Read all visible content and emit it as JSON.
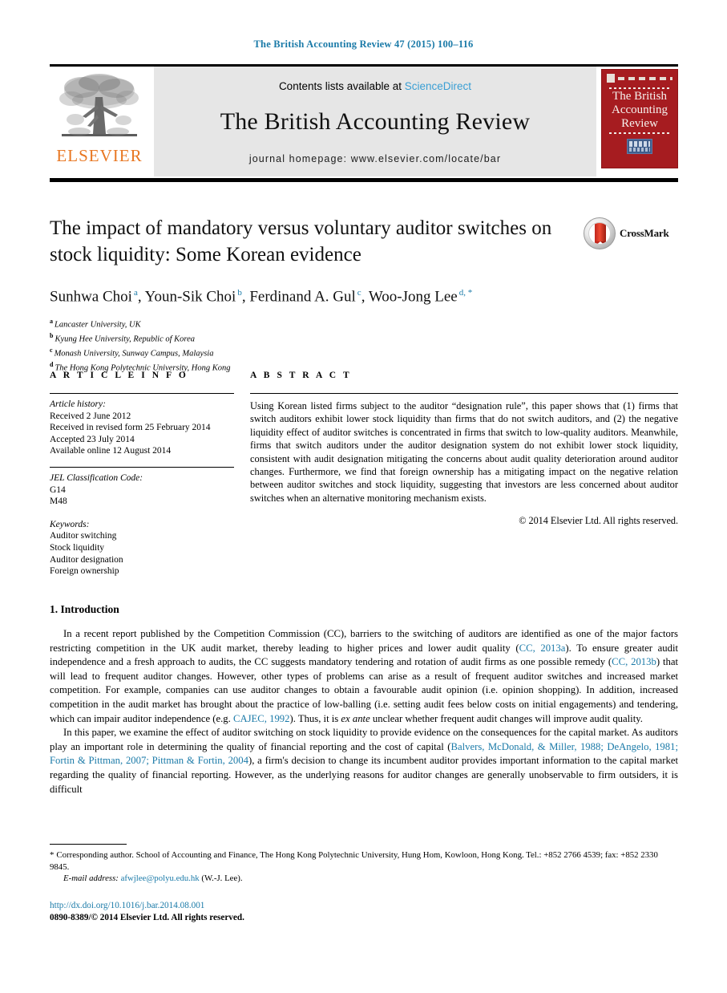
{
  "running_head": "The British Accounting Review 47 (2015) 100–116",
  "masthead": {
    "publisher_name": "ELSEVIER",
    "contents_prefix": "Contents lists available at ",
    "contents_link": "ScienceDirect",
    "journal_title": "The British Accounting Review",
    "homepage": "journal homepage: www.elsevier.com/locate/bar",
    "cover": {
      "line1": "The British",
      "line2": "Accounting",
      "line3": "Review",
      "society_badge": "BAFA"
    }
  },
  "article": {
    "title": "The impact of mandatory versus voluntary auditor switches on stock liquidity: Some Korean evidence",
    "crossmark_label": "CrossMark",
    "authors": [
      {
        "name": "Sunhwa Choi",
        "marks": "a"
      },
      {
        "name": "Youn-Sik Choi",
        "marks": "b"
      },
      {
        "name": "Ferdinand A. Gul",
        "marks": "c"
      },
      {
        "name": "Woo-Jong Lee",
        "marks": "d, *"
      }
    ],
    "affiliations": [
      {
        "mark": "a",
        "text": "Lancaster University, UK"
      },
      {
        "mark": "b",
        "text": "Kyung Hee University, Republic of Korea"
      },
      {
        "mark": "c",
        "text": "Monash University, Sunway Campus, Malaysia"
      },
      {
        "mark": "d",
        "text": "The Hong Kong Polytechnic University, Hong Kong"
      }
    ]
  },
  "article_info": {
    "heading": "A R T I C L E    I N F O",
    "history_label": "Article history:",
    "history": [
      "Received 2 June 2012",
      "Received in revised form 25 February 2014",
      "Accepted 23 July 2014",
      "Available online 12 August 2014"
    ],
    "jel_label": "JEL Classification Code:",
    "jel_codes": [
      "G14",
      "M48"
    ],
    "keywords_label": "Keywords:",
    "keywords": [
      "Auditor switching",
      "Stock liquidity",
      "Auditor designation",
      "Foreign ownership"
    ]
  },
  "abstract": {
    "heading": "A B S T R A C T",
    "text": "Using Korean listed firms subject to the auditor “designation rule”, this paper shows that (1) firms that switch auditors exhibit lower stock liquidity than firms that do not switch auditors, and (2) the negative liquidity effect of auditor switches is concentrated in firms that switch to low-quality auditors. Meanwhile, firms that switch auditors under the auditor designation system do not exhibit lower stock liquidity, consistent with audit designation mitigating the concerns about audit quality deterioration around auditor changes. Furthermore, we find that foreign ownership has a mitigating impact on the negative relation between auditor switches and stock liquidity, suggesting that investors are less concerned about auditor switches when an alternative monitoring mechanism exists.",
    "copyright": "© 2014 Elsevier Ltd. All rights reserved."
  },
  "body": {
    "section_heading": "1. Introduction",
    "paragraph1_part1": "In a recent report published by the Competition Commission (CC), barriers to the switching of auditors are identified as one of the major factors restricting competition in the UK audit market, thereby leading to higher prices and lower audit quality (",
    "cite_cc_2013a": "CC, 2013a",
    "paragraph1_part2": "). To ensure greater audit independence and a fresh approach to audits, the CC suggests mandatory tendering and rotation of audit firms as one possible remedy (",
    "cite_cc_2013b": "CC, 2013b",
    "paragraph1_part3": ") that will lead to frequent auditor changes. However, other types of problems can arise as a result of frequent auditor switches and increased market competition. For example, companies can use auditor changes to obtain a favourable audit opinion (i.e. opinion shopping). In addition, increased competition in the audit market has brought about the practice of low-balling (i.e. setting audit fees below costs on initial engagements) and tendering, which can impair auditor independence (e.g. ",
    "cite_cajec": "CAJEC, 1992",
    "paragraph1_part4a": "). Thus, it is ",
    "paragraph1_italic": "ex ante",
    "paragraph1_part4b": " unclear whether frequent audit changes will improve audit quality.",
    "paragraph2_part1": "In this paper, we examine the effect of auditor switching on stock liquidity to provide evidence on the consequences for the capital market. As auditors play an important role in determining the quality of financial reporting and the cost of capital (",
    "cite_group": "Balvers, McDonald, & Miller, 1988; DeAngelo, 1981; Fortin & Pittman, 2007; Pittman & Fortin, 2004",
    "paragraph2_part2": "), a firm's decision to change its incumbent auditor provides important information to the capital market regarding the quality of financial reporting. However, as the underlying reasons for auditor changes are generally unobservable to firm outsiders, it is difficult"
  },
  "footnote": {
    "star": "*",
    "corresponding": "Corresponding author. School of Accounting and Finance, The Hong Kong Polytechnic University, Hung Hom, Kowloon, Hong Kong. Tel.: +852 2766 4539; fax: +852 2330 9845.",
    "email_label": "E-mail address:",
    "email": "afwjlee@polyu.edu.hk",
    "email_suffix": "(W.-J. Lee)."
  },
  "doi_block": {
    "doi": "http://dx.doi.org/10.1016/j.bar.2014.08.001",
    "issn_line": "0890-8389/© 2014 Elsevier Ltd. All rights reserved."
  },
  "colors": {
    "link_blue": "#1a7aa8",
    "sciencedirect_blue": "#3a9fd4",
    "elsevier_orange": "#E87722",
    "cover_red": "#a61c20"
  }
}
